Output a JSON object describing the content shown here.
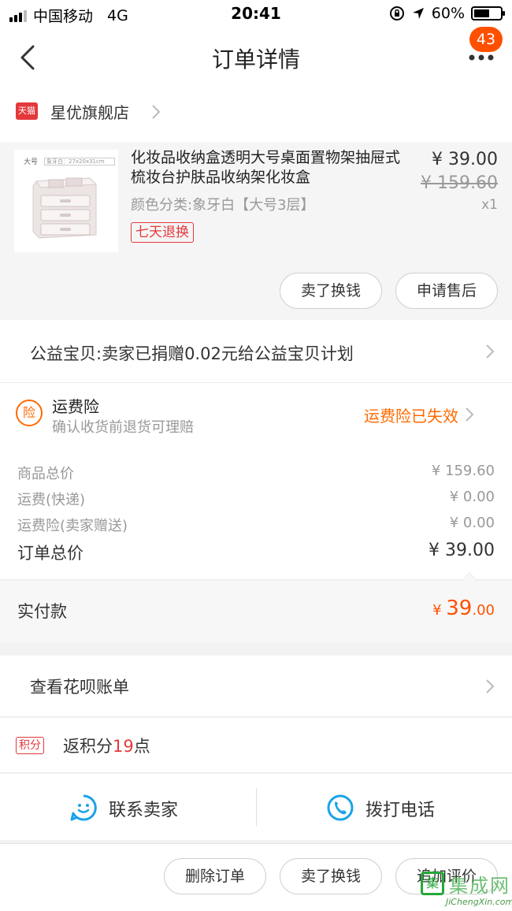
{
  "status_bar": {
    "carrier": "中国移动",
    "network": "4G",
    "time": "20:41",
    "battery_percent_text": "60%",
    "battery_level": 0.6
  },
  "nav": {
    "title": "订单详情",
    "badge_count": "43",
    "icons": {
      "back": "chevron-left-icon",
      "more": "more-dots-icon"
    }
  },
  "shop": {
    "logo_text": "天猫",
    "name": "星优旗舰店"
  },
  "product": {
    "thumb_tag": "大号",
    "thumb_dims": "象牙白：27x20x31cm",
    "title": "化妆品收纳盒透明大号桌面置物架抽屉式梳妆台护肤品收纳架化妆盒",
    "sku": "颜色分类:象牙白【大号3层】",
    "service_tag": "七天退换",
    "price": "¥ 39.00",
    "original_price": "¥ 159.60",
    "quantity": "x1",
    "buttons": {
      "sell": "卖了换钱",
      "after_sale": "申请售后"
    }
  },
  "charity": {
    "text": "公益宝贝:卖家已捐赠0.02元给公益宝贝计划"
  },
  "insurance": {
    "icon_text": "险",
    "title": "运费险",
    "subtitle": "确认收货前退货可理赔",
    "status": "运费险已失效",
    "colors": {
      "accent": "#ff6a00"
    }
  },
  "summary": {
    "rows": [
      {
        "label": "商品总价",
        "value": "¥ 159.60"
      },
      {
        "label": "运费(快递)",
        "value": "¥ 0.00"
      },
      {
        "label": "运费险(卖家赠送)",
        "value": "¥ 0.00"
      }
    ],
    "total_label": "订单总价",
    "total_value": "¥ 39.00"
  },
  "paid": {
    "label": "实付款",
    "currency": "¥ ",
    "integer": "39",
    "decimal": ".00",
    "color": "#ff5000"
  },
  "huabei": {
    "text": "查看花呗账单"
  },
  "points": {
    "badge": "积分",
    "prefix": "返积分",
    "number": "19",
    "suffix": "点"
  },
  "contact": {
    "seller_label": "联系卖家",
    "phone_label": "拨打电话",
    "colors": {
      "icon": "#1aa3e8"
    }
  },
  "bottom_actions": {
    "delete": "删除订单",
    "sell": "卖了换钱",
    "review": "追加评价"
  },
  "watermark": {
    "text": "集成网",
    "url": "JiChengXin.com"
  }
}
